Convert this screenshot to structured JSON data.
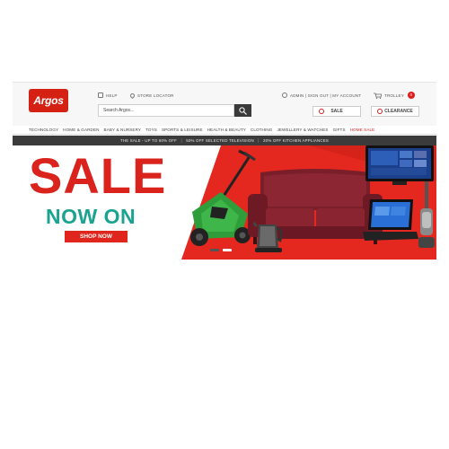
{
  "header": {
    "logo_text": "Argos",
    "help_label": "HELP",
    "store_locator_label": "STORE LOCATOR",
    "account_links": "ADMIN | SIGN OUT | MY ACCOUNT",
    "trolley_label": "TROLLEY",
    "trolley_count": "0",
    "search_placeholder": "Search Argos...",
    "sale_button_label": "SALE",
    "clearance_button_label": "CLEARANCE"
  },
  "nav": {
    "items": [
      {
        "label": "TECHNOLOGY"
      },
      {
        "label": "HOME & GARDEN"
      },
      {
        "label": "BABY & NURSERY"
      },
      {
        "label": "TOYS"
      },
      {
        "label": "SPORTS & LEISURE"
      },
      {
        "label": "HEALTH & BEAUTY"
      },
      {
        "label": "CLOTHING"
      },
      {
        "label": "JEWELLERY & WATCHES"
      },
      {
        "label": "GIFTS"
      },
      {
        "label": "HOME SALE"
      }
    ]
  },
  "promo_bar": {
    "items": [
      "THE SALE - UP TO 60% OFF",
      "50% OFF SELECTED TELEVISION",
      "20% OFF KITCHEN APPLIANCES"
    ]
  },
  "banner": {
    "headline": "SALE",
    "subheadline": "NOW ON",
    "cta_label": "SHOP NOW",
    "slides_total": 2,
    "active_slide": 2
  },
  "colors": {
    "brand_red": "#d42114",
    "banner_red": "#e4281f",
    "teal": "#1aa38f",
    "promo_bar": "#3b3b3b"
  }
}
